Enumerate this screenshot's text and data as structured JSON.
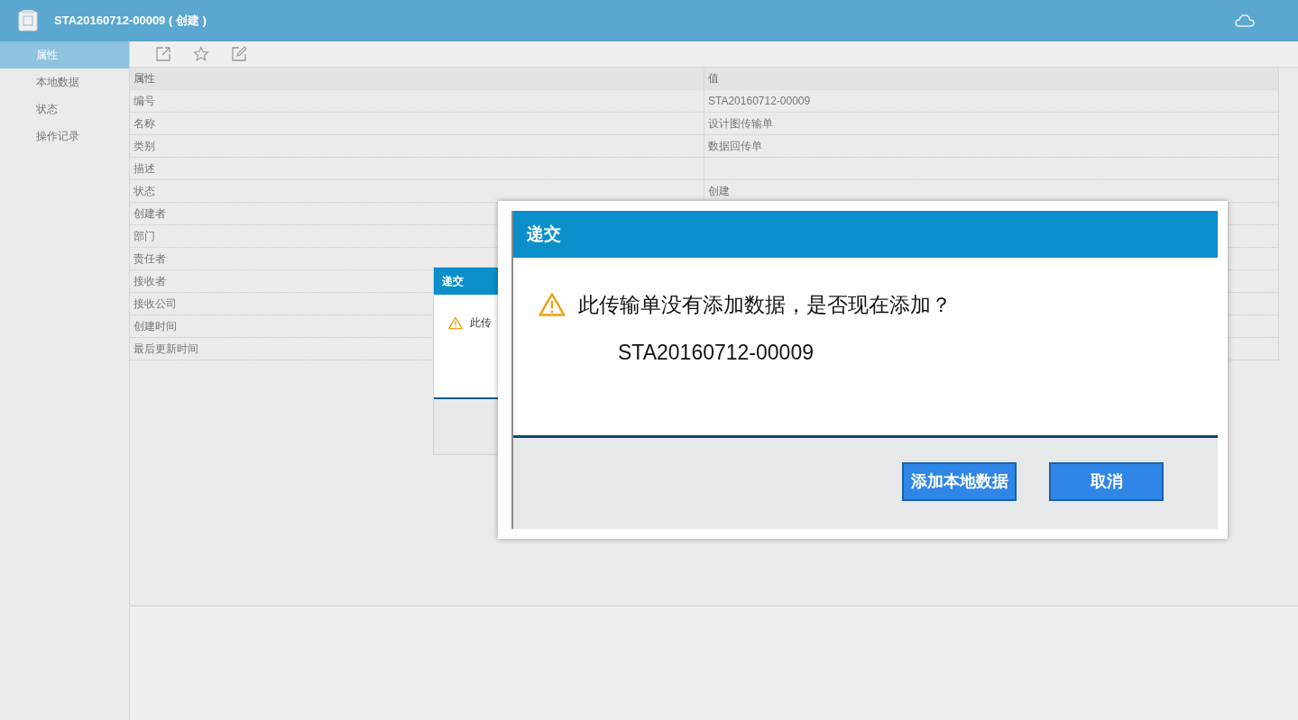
{
  "header": {
    "title": "STA20160712-00009 ( 创建 )"
  },
  "sidebar": {
    "items": [
      {
        "label": "属性",
        "selected": true
      },
      {
        "label": "本地数据",
        "selected": false
      },
      {
        "label": "状态",
        "selected": false
      },
      {
        "label": "操作记录",
        "selected": false
      }
    ]
  },
  "table": {
    "columns": [
      "属性",
      "值"
    ],
    "rows": [
      {
        "name": "编号",
        "value": "STA20160712-00009"
      },
      {
        "name": "名称",
        "value": "设计图传输单"
      },
      {
        "name": "类别",
        "value": "数据回传单"
      },
      {
        "name": "描述"
      },
      {
        "name": "状态",
        "value": "创建"
      },
      {
        "name": "创建者"
      },
      {
        "name": "部门"
      },
      {
        "name": "责任者"
      },
      {
        "name": "接收者"
      },
      {
        "name": "接收公司"
      },
      {
        "name": "创建时间"
      },
      {
        "name": "最后更新时间"
      }
    ]
  },
  "back_dialog": {
    "title": "递交",
    "message": "此传"
  },
  "dialog": {
    "title": "递交",
    "message": "此传输单没有添加数据，是否现在添加？",
    "detail": "STA20160712-00009",
    "buttons": [
      "添加本地数据",
      "取消"
    ]
  }
}
